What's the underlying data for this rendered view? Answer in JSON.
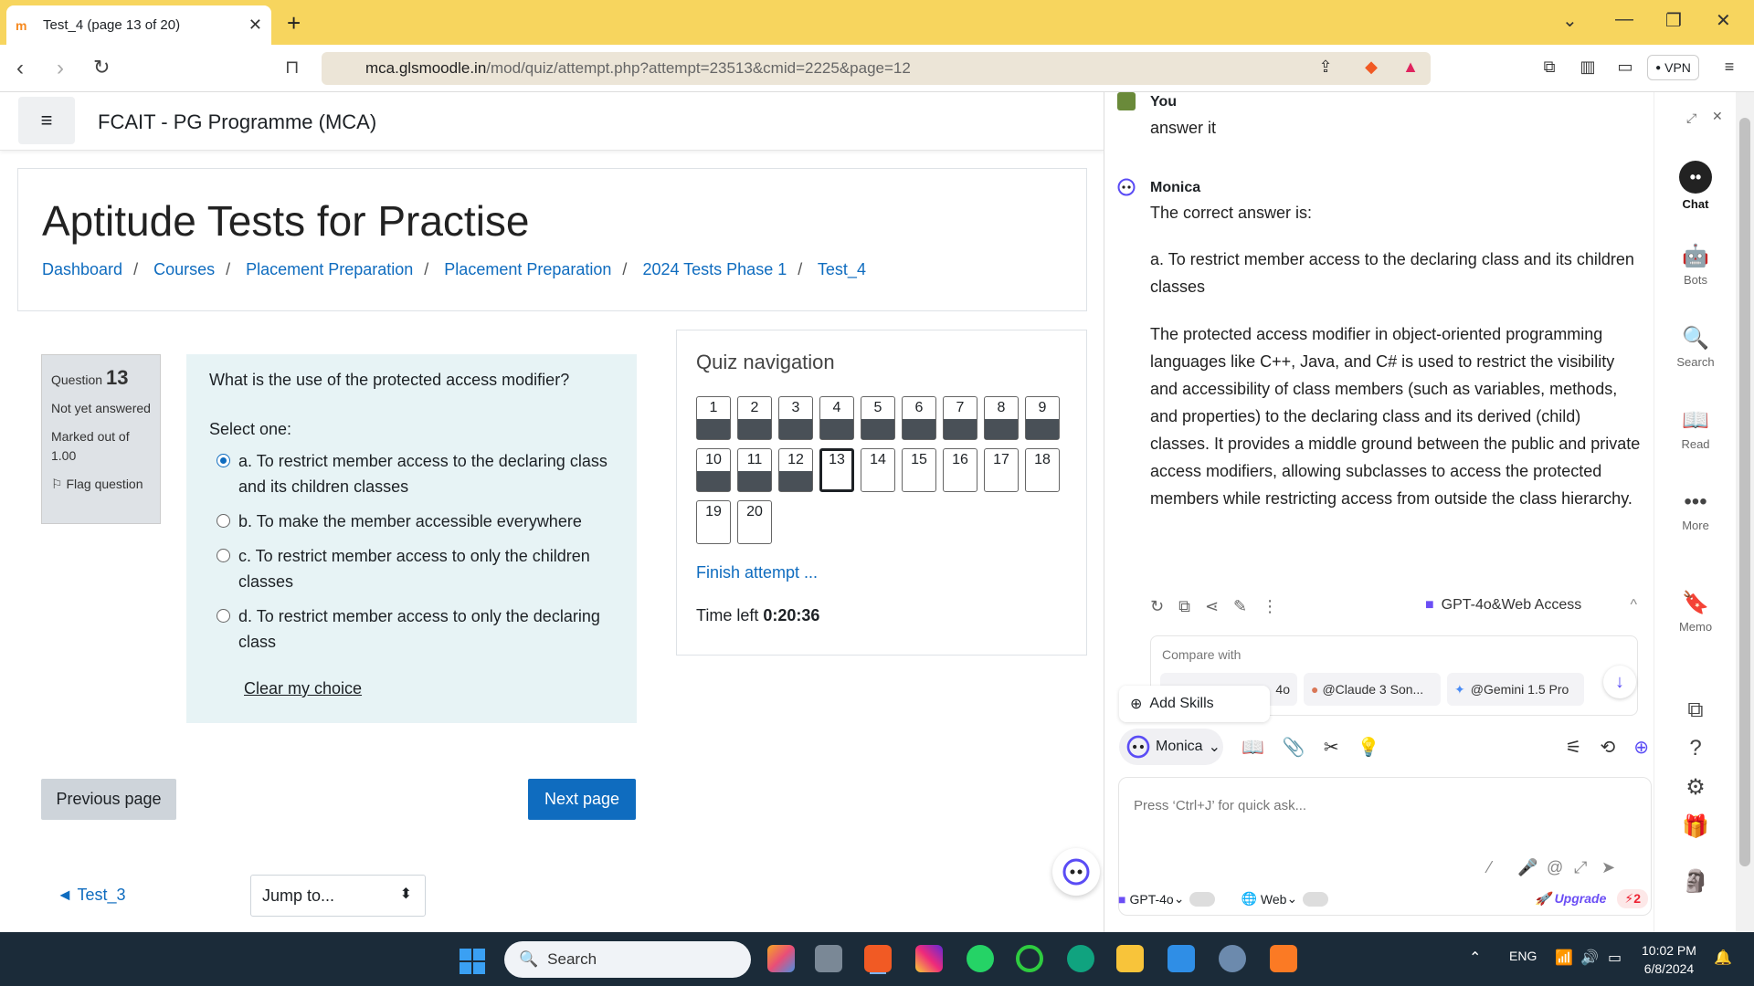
{
  "browser": {
    "tab_title": "Test_4 (page 13 of 20)",
    "url_host": "mca.glsmoodle.in",
    "url_path": "/mod/quiz/attempt.php?attempt=23513&cmid=2225&page=12",
    "vpn_label": "VPN"
  },
  "moodle": {
    "site_name": "FCAIT - PG Programme (MCA)",
    "page_title": "Aptitude Tests for Practise",
    "breadcrumb": [
      "Dashboard",
      "Courses",
      "Placement Preparation",
      "Placement Preparation",
      "2024 Tests Phase 1",
      "Test_4"
    ],
    "question": {
      "label": "Question",
      "number": "13",
      "status": "Not yet answered",
      "marked": "Marked out of 1.00",
      "flag": "Flag question",
      "text": "What is the use of the protected access modifier?",
      "select_label": "Select one:",
      "options": [
        "a. To restrict member access to the declaring class and its children classes",
        "b. To make the member accessible everywhere",
        "c. To restrict member access to only the children classes",
        "d. To restrict member access to only the declaring class"
      ],
      "selected_index": 0,
      "clear": "Clear my choice"
    },
    "prev_button": "Previous page",
    "next_button": "Next page",
    "prev_activity": "◄ Test_3",
    "jump_to": "Jump to...",
    "quiz_nav": {
      "title": "Quiz navigation",
      "buttons": [
        "1",
        "2",
        "3",
        "4",
        "5",
        "6",
        "7",
        "8",
        "9",
        "10",
        "11",
        "12",
        "13",
        "14",
        "15",
        "16",
        "17",
        "18",
        "19",
        "20"
      ],
      "answered": [
        1,
        2,
        3,
        4,
        5,
        6,
        7,
        8,
        9,
        10,
        11,
        12
      ],
      "current": 13,
      "finish": "Finish attempt ...",
      "time_label": "Time left",
      "time_value": "0:20:36"
    }
  },
  "monica": {
    "user_name": "You",
    "user_msg": "answer it",
    "bot_name": "Monica",
    "answer_intro": "The correct answer is:",
    "answer_choice": "a. To restrict member access to the declaring class and its children classes",
    "answer_body": "The protected access modifier in object-oriented programming languages like C++, Java, and C# is used to restrict the visibility and accessibility of class members (such as variables, methods, and properties) to the declaring class and its derived (child) classes. It provides a middle ground between the public and private access modifiers, allowing subclasses to access the protected members while restricting access from outside the class hierarchy.",
    "model_pill": "GPT-4o&Web Access",
    "compare_with": "Compare with",
    "compare_chips": [
      "4o",
      "@Claude 3 Son...",
      "@Gemini 1.5 Pro"
    ],
    "add_skills": "Add Skills",
    "selector": "Monica",
    "input_placeholder": "Press ‘Ctrl+J’ for quick ask...",
    "bottom": {
      "model": "GPT-4o",
      "web": "Web",
      "upgrade": "Upgrade",
      "count": "2"
    },
    "rail": [
      "Chat",
      "Bots",
      "Search",
      "Read",
      "More",
      "Memo"
    ]
  },
  "taskbar": {
    "search": "Search",
    "lang": "ENG",
    "time": "10:02 PM",
    "date": "6/8/2024"
  }
}
